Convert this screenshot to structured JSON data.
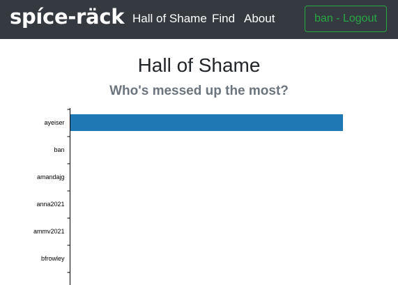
{
  "navbar": {
    "brand": "spíce-räck",
    "links": [
      {
        "label": "Hall of Shame"
      },
      {
        "label": "Find"
      },
      {
        "label": "About"
      }
    ],
    "logout_label": "ban - Logout",
    "background": "#343a40",
    "button_color": "#28a745"
  },
  "page": {
    "title": "Hall of Shame",
    "subtitle": "Who's messed up the most?"
  },
  "chart_data": {
    "type": "bar",
    "orientation": "horizontal",
    "categories": [
      "ayeiser",
      "ban",
      "amandajg",
      "anna2021",
      "ammv2021",
      "bfrowley"
    ],
    "values": [
      1,
      0,
      0,
      0,
      0,
      0
    ],
    "bar_color": "#1f77b4",
    "title": "",
    "xlabel": "",
    "ylabel": "",
    "xlim": [
      0,
      1
    ],
    "grid": false,
    "legend": "none"
  }
}
